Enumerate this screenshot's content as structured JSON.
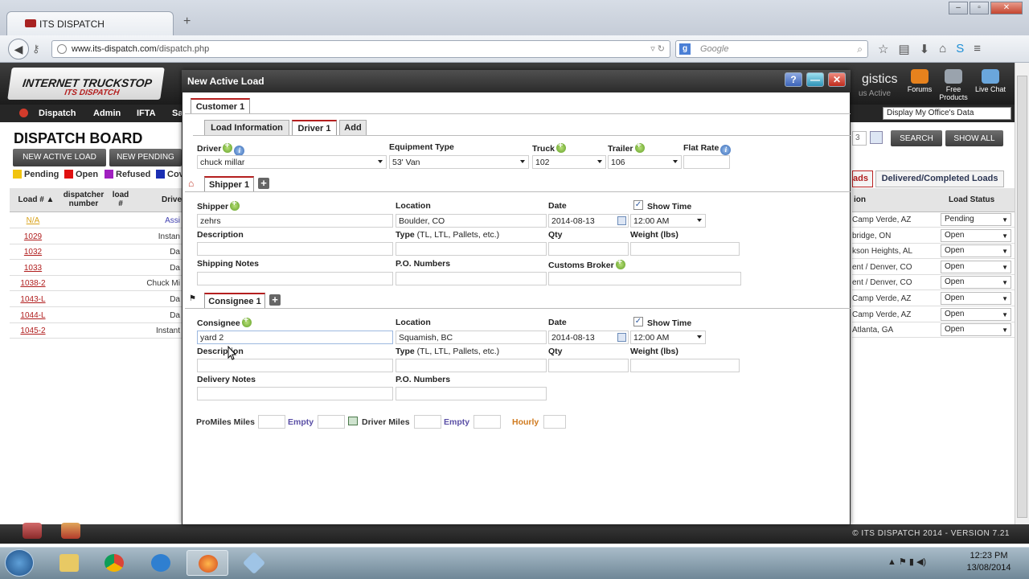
{
  "browser": {
    "tab_title": "ITS DISPATCH",
    "url_host": "www.its-dispatch.com",
    "url_path": "/dispatch.php",
    "search_placeholder": "Google",
    "search_engine_letter": "g"
  },
  "header": {
    "logo_line1": "INTERNET TRUCKSTOP",
    "logo_line2": "ITS DISPATCH",
    "right_text": "gistics",
    "right_subtext": "us Active",
    "icons": [
      {
        "label": "Forums",
        "icon": "forums-icon"
      },
      {
        "label": "Free Products",
        "icon": "free-products-icon"
      },
      {
        "label": "Live Chat",
        "icon": "live-chat-icon"
      }
    ],
    "office_dropdown": "Display My Office's Data"
  },
  "menu": [
    "Dispatch",
    "Admin",
    "IFTA",
    "Sa"
  ],
  "board": {
    "title": "DISPATCH BOARD",
    "btn_new_active": "NEW ACTIVE LOAD",
    "btn_new_pending": "NEW PENDING",
    "btn_search": "SEARCH",
    "btn_show_all": "SHOW ALL",
    "search_fragment": "3",
    "legend": [
      {
        "label": "Pending",
        "color": "#f1c40f"
      },
      {
        "label": "Open",
        "color": "#e01010"
      },
      {
        "label": "Refused",
        "color": "#a020c0"
      },
      {
        "label": "Cov",
        "color": "#1b2fb3"
      }
    ],
    "left_headers": [
      "Load # ▲",
      "dispatcher number",
      "load #",
      "Drive"
    ],
    "left_rows": [
      {
        "id": "N/A",
        "driver": "Assi"
      },
      {
        "id": "1029",
        "driver": "Instan"
      },
      {
        "id": "1032",
        "driver": "Da"
      },
      {
        "id": "1033",
        "driver": "Da"
      },
      {
        "id": "1038-2",
        "driver": "Chuck Mi"
      },
      {
        "id": "1043-L",
        "driver": "Da"
      },
      {
        "id": "1044-L",
        "driver": "Da"
      },
      {
        "id": "1045-2",
        "driver": "Instant"
      }
    ],
    "right_tab_loads": "ads",
    "right_tab_completed": "Delivered/Completed Loads",
    "right_headers": [
      "ion",
      "Load Status"
    ],
    "right_rows": [
      {
        "loc": "Camp Verde, AZ",
        "status": "Pending"
      },
      {
        "loc": "bridge, ON",
        "status": "Open"
      },
      {
        "loc": "kson Heights, AL",
        "status": "Open"
      },
      {
        "loc": "ent / Denver, CO",
        "status": "Open"
      },
      {
        "loc": "ent / Denver, CO",
        "status": "Open"
      },
      {
        "loc": "Camp Verde, AZ",
        "status": "Open"
      },
      {
        "loc": "Camp Verde, AZ",
        "status": "Open"
      },
      {
        "loc": "Atlanta, GA",
        "status": "Open"
      }
    ]
  },
  "modal": {
    "title": "New Active Load",
    "customer_tab": "Customer 1",
    "tabs": [
      "Load Information",
      "Driver 1",
      "Add"
    ],
    "driver": {
      "driver_label": "Driver",
      "driver_value": "chuck millar",
      "equipment_label": "Equipment Type",
      "equipment_value": "53' Van",
      "truck_label": "Truck",
      "truck_value": "102",
      "trailer_label": "Trailer",
      "trailer_value": "106",
      "flat_rate_label": "Flat Rate",
      "flat_rate_value": ""
    },
    "shipper": {
      "tab": "Shipper 1",
      "shipper_label": "Shipper",
      "shipper_value": "zehrs",
      "location_label": "Location",
      "location_value": "Boulder, CO",
      "date_label": "Date",
      "date_value": "2014-08-13",
      "show_time_label": "Show Time",
      "show_time_checked": "✓",
      "time_value": "12:00 AM",
      "description_label": "Description",
      "type_label": "Type",
      "type_hint": "(TL, LTL, Pallets, etc.)",
      "qty_label": "Qty",
      "weight_label": "Weight (lbs)",
      "notes_label": "Shipping Notes",
      "po_label": "P.O. Numbers",
      "customs_label": "Customs Broker"
    },
    "consignee": {
      "tab": "Consignee 1",
      "consignee_label": "Consignee",
      "consignee_value": "yard 2",
      "location_label": "Location",
      "location_value": "Squamish, BC",
      "date_label": "Date",
      "date_value": "2014-08-13",
      "show_time_label": "Show Time",
      "show_time_checked": "✓",
      "time_value": "12:00 AM",
      "description_label": "Description",
      "type_label": "Type",
      "type_hint": "(TL, LTL, Pallets, etc.)",
      "qty_label": "Qty",
      "weight_label": "Weight (lbs)",
      "notes_label": "Delivery Notes",
      "po_label": "P.O. Numbers"
    },
    "miles": {
      "promiles_label": "ProMiles Miles",
      "empty_label_1": "Empty",
      "driver_miles_label": "Driver Miles",
      "empty_label_2": "Empty",
      "hourly_label": "Hourly"
    }
  },
  "footer": {
    "text": "© ITS DISPATCH 2014 - VERSION 7.21"
  },
  "taskbar": {
    "time": "12:23 PM",
    "date": "13/08/2014"
  },
  "colors": {
    "brand_red": "#b51f1f",
    "dark_bar": "#2b2b2b",
    "link_red": "#b01d1d"
  }
}
